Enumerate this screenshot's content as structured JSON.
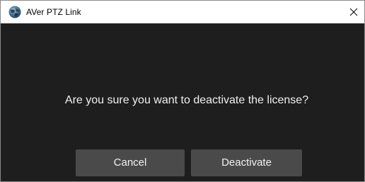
{
  "window": {
    "title": "AVer PTZ Link",
    "app_icon": "aver-globe-icon",
    "close_icon": "close-icon"
  },
  "dialog": {
    "message": "Are you sure you want to deactivate the license?",
    "cancel_label": "Cancel",
    "deactivate_label": "Deactivate"
  },
  "colors": {
    "background": "#1e1e1e",
    "button": "#4a4a4a",
    "text": "#f0f0f0",
    "titlebar": "#ffffff"
  }
}
